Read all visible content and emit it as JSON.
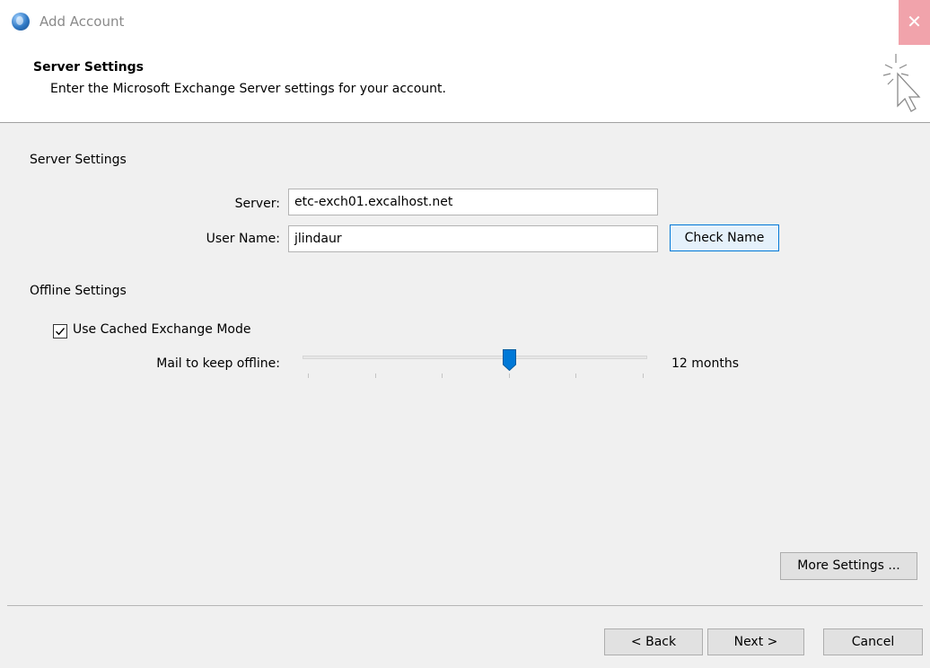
{
  "window": {
    "title": "Add Account",
    "close_glyph": "✕"
  },
  "header": {
    "title": "Server Settings",
    "description": "Enter the Microsoft Exchange Server settings for your account.",
    "icon": "wizard-cursor-icon"
  },
  "server_settings": {
    "section_label": "Server Settings",
    "server_label": "Server:",
    "server_value": "etc-exch01.excalhost.net",
    "username_label": "User Name:",
    "username_value": "jlindaur",
    "check_name_button": "Check Name"
  },
  "offline_settings": {
    "section_label": "Offline Settings",
    "cached_mode_label": "Use Cached Exchange Mode",
    "cached_mode_checked": true,
    "mail_offline_label": "Mail to keep offline:",
    "mail_offline_value": "12 months",
    "slider_fraction": 0.6,
    "slider_tick_count": 6
  },
  "more_settings_button": "More Settings ...",
  "footer": {
    "back_button": "< Back",
    "next_button": "Next >",
    "cancel_button": "Cancel"
  },
  "colors": {
    "accent": "#0078d7",
    "close_hover": "#f1a3ab"
  }
}
